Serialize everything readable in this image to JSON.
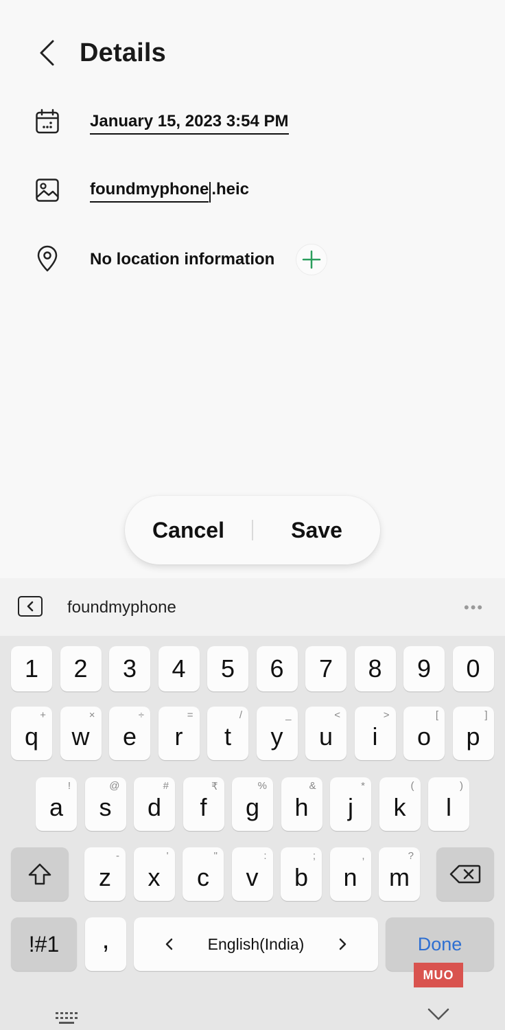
{
  "header": {
    "title": "Details"
  },
  "details": {
    "date": "January 15, 2023 3:54 PM",
    "file_base": "foundmyphone",
    "file_ext": ".heic",
    "location": "No location information"
  },
  "actions": {
    "cancel": "Cancel",
    "save": "Save"
  },
  "suggestion": {
    "word": "foundmyphone",
    "more": "•••"
  },
  "keyboard": {
    "numbers": [
      "1",
      "2",
      "3",
      "4",
      "5",
      "6",
      "7",
      "8",
      "9",
      "0"
    ],
    "row1": [
      {
        "k": "q",
        "h": "+"
      },
      {
        "k": "w",
        "h": "×"
      },
      {
        "k": "e",
        "h": "÷"
      },
      {
        "k": "r",
        "h": "="
      },
      {
        "k": "t",
        "h": "/"
      },
      {
        "k": "y",
        "h": "_"
      },
      {
        "k": "u",
        "h": "<"
      },
      {
        "k": "i",
        "h": ">"
      },
      {
        "k": "o",
        "h": "["
      },
      {
        "k": "p",
        "h": "]"
      }
    ],
    "row2": [
      {
        "k": "a",
        "h": "!"
      },
      {
        "k": "s",
        "h": "@"
      },
      {
        "k": "d",
        "h": "#"
      },
      {
        "k": "f",
        "h": "₹"
      },
      {
        "k": "g",
        "h": "%"
      },
      {
        "k": "h",
        "h": "&"
      },
      {
        "k": "j",
        "h": "*"
      },
      {
        "k": "k",
        "h": "("
      },
      {
        "k": "l",
        "h": ")"
      }
    ],
    "row3": [
      {
        "k": "z",
        "h": "-"
      },
      {
        "k": "x",
        "h": "'"
      },
      {
        "k": "c",
        "h": "\""
      },
      {
        "k": "v",
        "h": ":"
      },
      {
        "k": "b",
        "h": ";"
      },
      {
        "k": "n",
        "h": ","
      },
      {
        "k": "m",
        "h": "?"
      }
    ],
    "symbols": "!#1",
    "comma": ",",
    "language": "English(India)",
    "done": "Done"
  },
  "watermark": "MUO"
}
